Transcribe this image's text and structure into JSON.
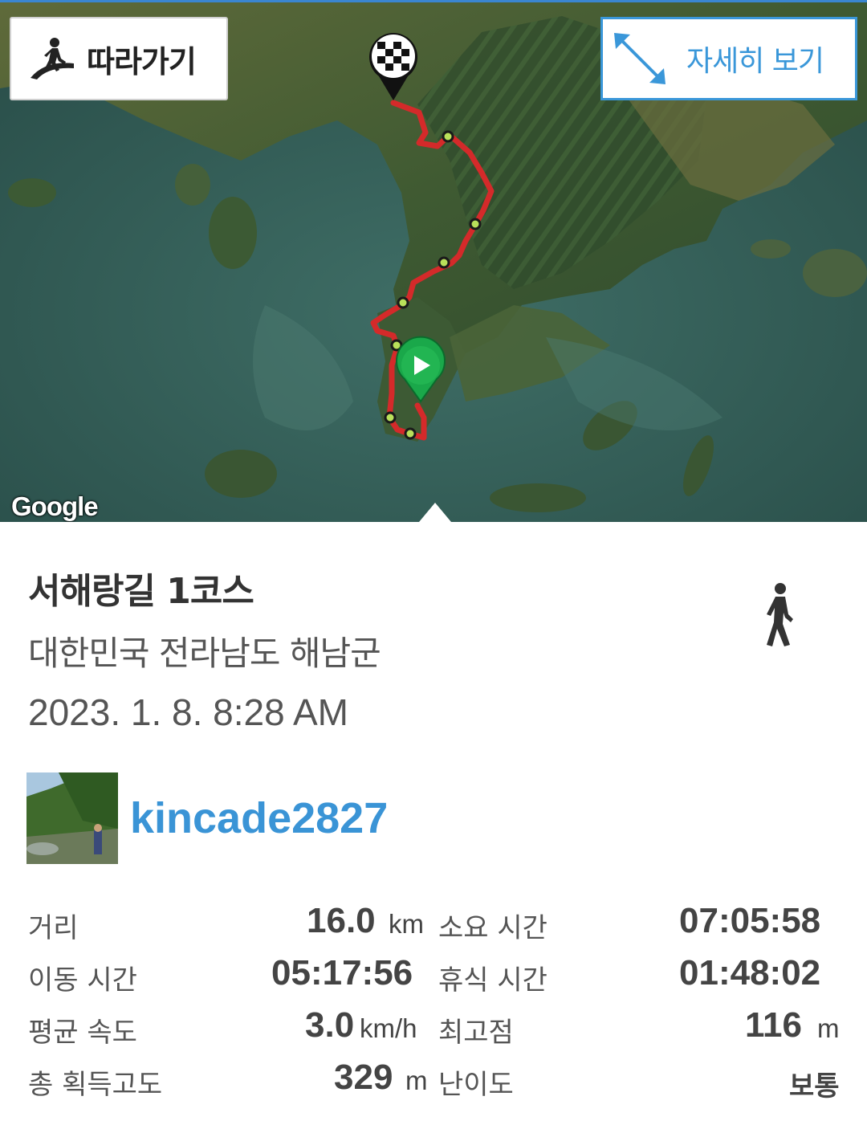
{
  "map": {
    "follow_label": "따라가기",
    "detail_label": "자세히 보기",
    "google_logo": "Google",
    "start_icon": "play-icon",
    "finish_icon": "checkered-flag-icon",
    "route_color": "#d42a2a",
    "accent": "#3a97d9"
  },
  "trip": {
    "title": "서해랑길 1코스",
    "location": "대한민국 전라남도 해남군",
    "date": "2023. 1. 8. 8:28 AM",
    "activity_icon": "walking-icon"
  },
  "user": {
    "name": "kincade2827",
    "avatar": "avatar-photo"
  },
  "stats": {
    "distance_label": "거리",
    "distance_value": "16.0",
    "distance_unit": "km",
    "total_time_label": "소요 시간",
    "total_time_value": "07:05:58",
    "moving_time_label": "이동 시간",
    "moving_time_value": "05:17:56",
    "rest_time_label": "휴식 시간",
    "rest_time_value": "01:48:02",
    "avg_speed_label": "평균 속도",
    "avg_speed_value": "3.0",
    "avg_speed_unit": "km/h",
    "max_alt_label": "최고점",
    "max_alt_value": "116",
    "max_alt_unit": "m",
    "gain_label": "총 획득고도",
    "gain_value": "329",
    "gain_unit": "m",
    "difficulty_label": "난이도",
    "difficulty_value": "보통"
  }
}
